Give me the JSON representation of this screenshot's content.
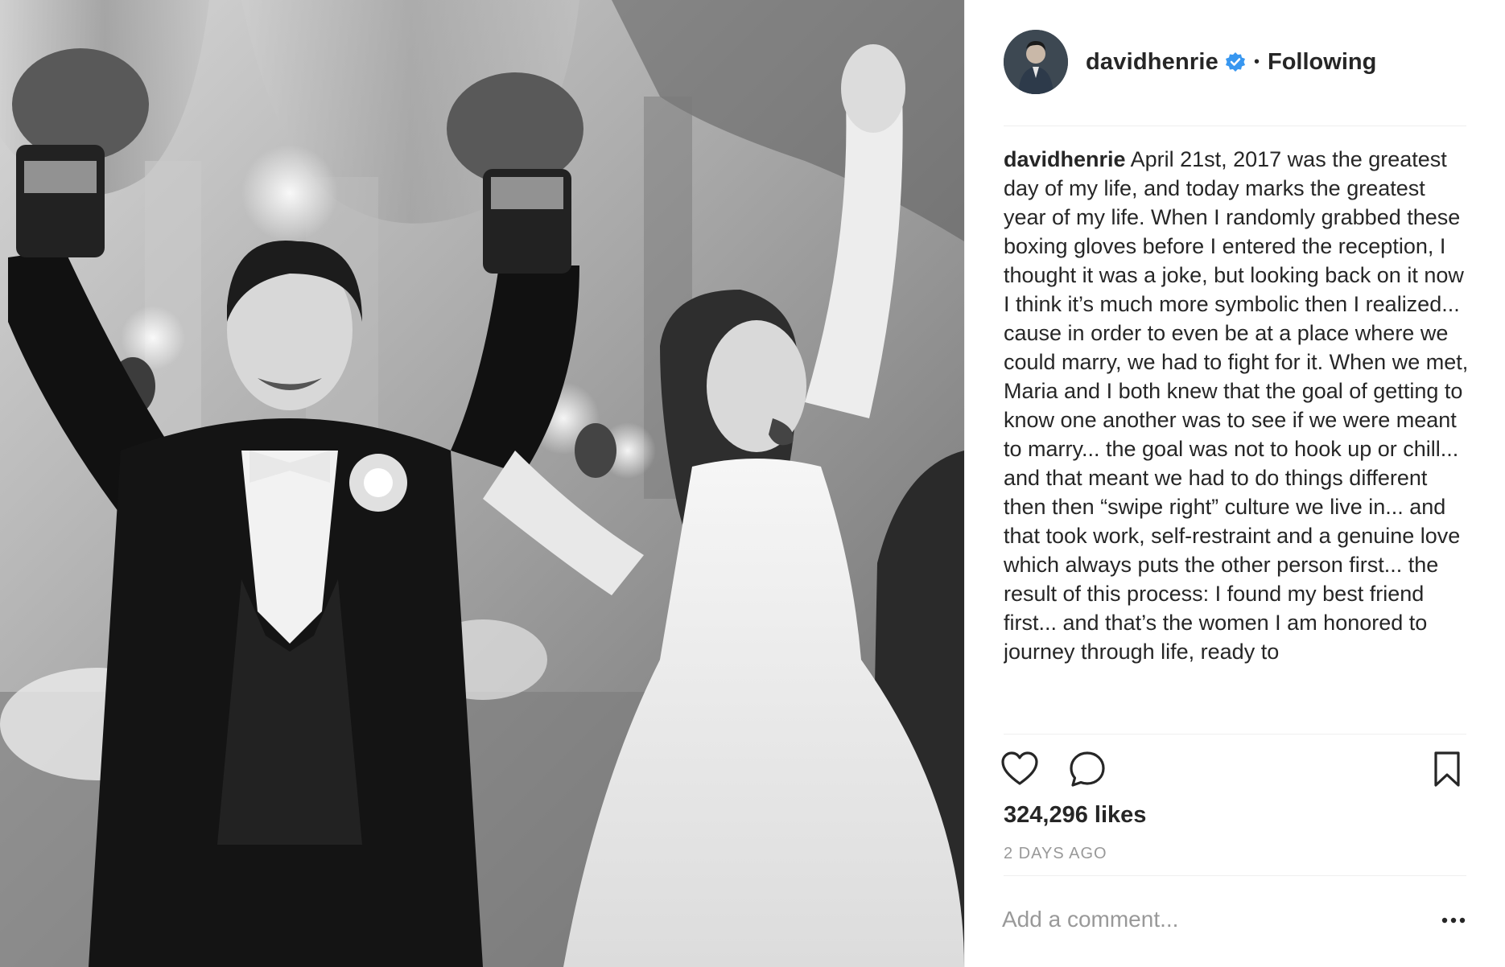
{
  "post": {
    "photo": {
      "subject": "black-and-white wedding photo: groom wearing boxing gloves and bride in lace gown, both with arms raised"
    },
    "header": {
      "username": "davidhenrie",
      "verified_icon": "verified-badge-icon",
      "separator": "•",
      "follow_status": "Following",
      "avatar_icon": "profile-avatar"
    },
    "caption": {
      "username": "davidhenrie",
      "text": "April 21st, 2017 was the greatest day of my life, and today marks the greatest year of my life. When I randomly grabbed these boxing gloves before I entered the reception, I thought it was a joke, but looking back on it now I think it’s much more symbolic then I realized... cause in order to even be at a place where we could marry, we had to fight for it. When we met, Maria and I both knew that the goal of getting to know one another was to see if we were meant to marry... the goal was not to hook up or chill... and that meant we had to do things different then then “swipe right” culture we live in... and that took work, self-restraint and a genuine love which always puts the other person first... the result of this process: I found my best friend first... and that’s the women I am honored to journey through life, ready to"
    },
    "actions": {
      "like_icon": "heart-icon",
      "comment_icon": "comment-bubble-icon",
      "save_icon": "bookmark-icon"
    },
    "likes": "324,296 likes",
    "timestamp": "2 DAYS AGO",
    "comment": {
      "placeholder": "Add a comment...",
      "value": "",
      "more_icon": "more-options-icon"
    },
    "colors": {
      "verified_blue": "#3897f0",
      "text": "#262626",
      "muted": "#999999",
      "divider": "#efefef"
    }
  }
}
